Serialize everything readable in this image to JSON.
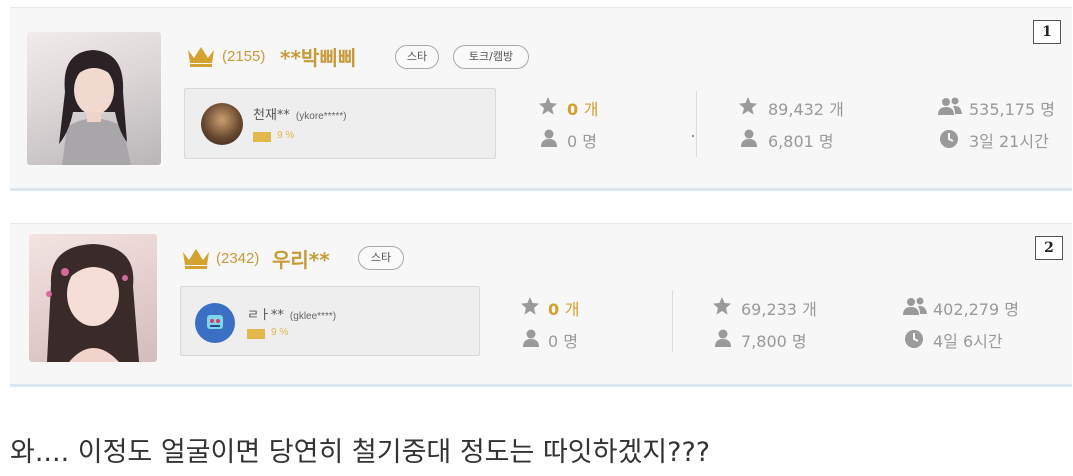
{
  "entries": [
    {
      "rank_badge": "1",
      "rank_count": "(2155)",
      "nickname": "**박삐삐",
      "tags": [
        "스타",
        "토크/캠방"
      ],
      "top_fan": {
        "name": "천재**",
        "id": "(ykore*****)",
        "percent": "9 %"
      },
      "stats": {
        "stars_today_value": "0",
        "stars_today_unit": "개",
        "fans_today": "0 명",
        "stars_total": "89,432 개",
        "fans_total": "6,801 명",
        "viewers": "535,175 명",
        "duration": "3일 21시간"
      }
    },
    {
      "rank_badge": "2",
      "rank_count": "(2342)",
      "nickname": "우리**",
      "tags": [
        "스타"
      ],
      "top_fan": {
        "name": "ㄹㅏ**",
        "id": "(gklee****)",
        "percent": "9 %"
      },
      "stats": {
        "stars_today_value": "0",
        "stars_today_unit": "개",
        "fans_today": "0 명",
        "stars_total": "69,233 개",
        "fans_total": "7,800 명",
        "viewers": "402,279 명",
        "duration": "4일 6시간"
      }
    }
  ],
  "caption": "와.... 이정도 얼굴이면 당연히 철기중대 정도는 따잇하겠지???",
  "colors": {
    "gold": "#c79b3a",
    "highlight": "#d69f2c",
    "muted": "#9a9a9a",
    "card_bg": "#f7f7f7",
    "card_border": "#dde7ef"
  },
  "icons": [
    "crown-icon",
    "star-icon",
    "person-icon",
    "people-icon",
    "clock-icon"
  ]
}
